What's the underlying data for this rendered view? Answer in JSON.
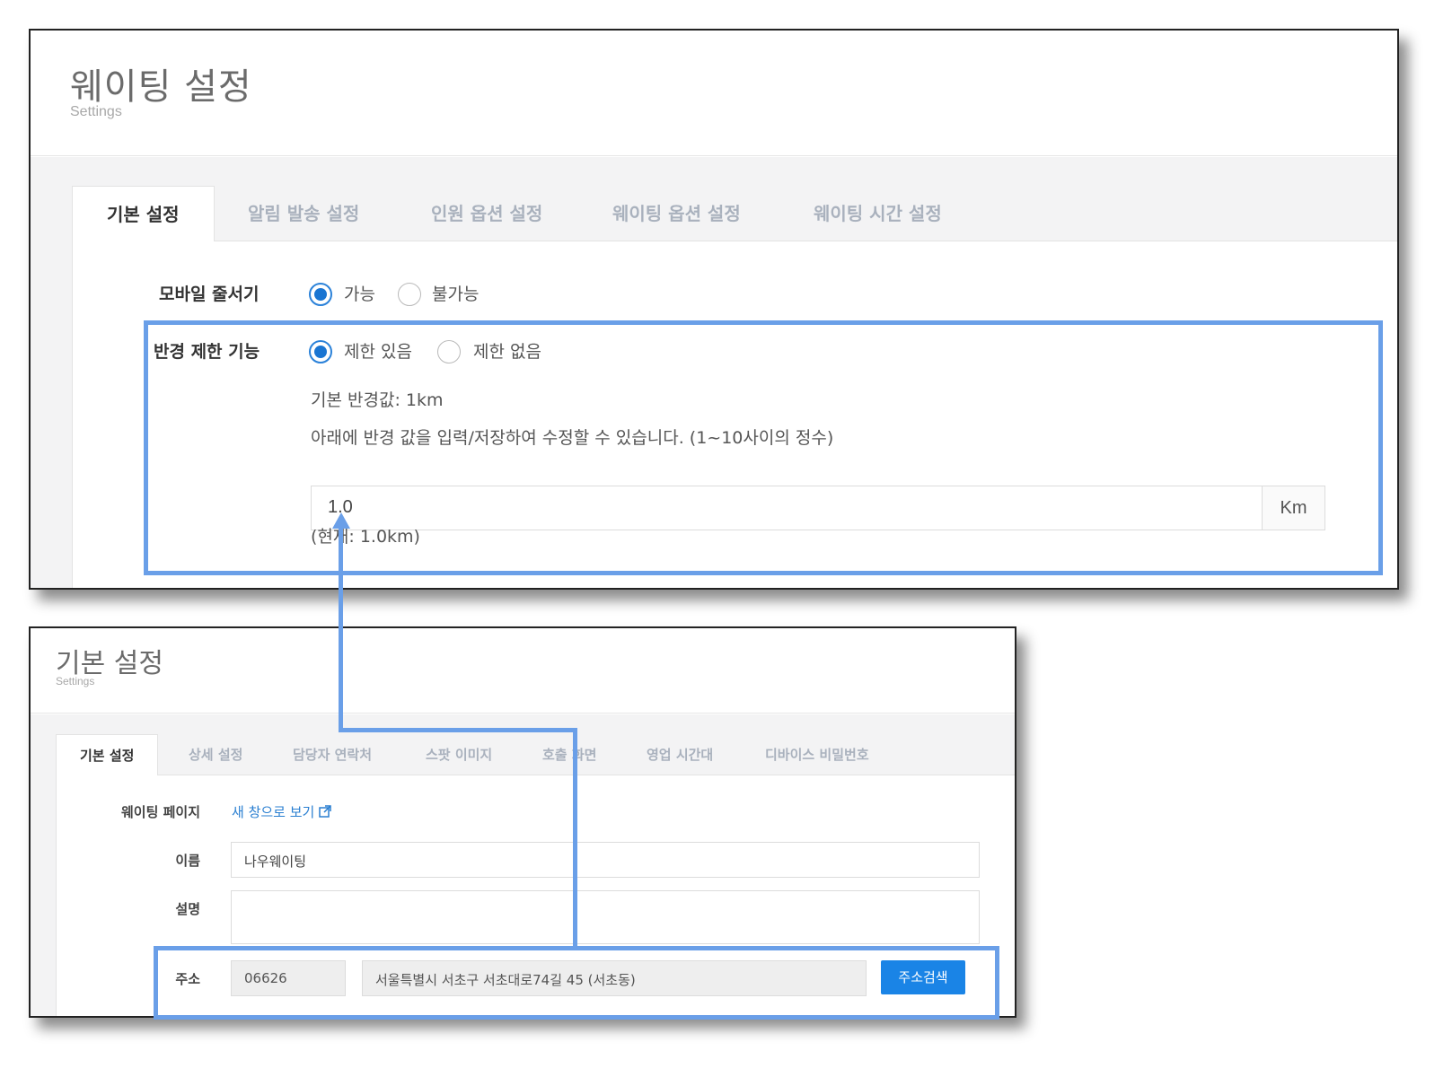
{
  "top_panel": {
    "title": "웨이팅 설정",
    "subtitle": "Settings",
    "tabs": [
      "기본 설정",
      "알림 발송 설정",
      "인원 옵션 설정",
      "웨이팅 옵션 설정",
      "웨이팅 시간 설정"
    ],
    "active_tab": "기본 설정",
    "mobile_queue": {
      "label": "모바일 줄서기",
      "options": [
        "가능",
        "불가능"
      ],
      "selected": "가능"
    },
    "radius_limit": {
      "label": "반경 제한 기능",
      "options": [
        "제한 있음",
        "제한 없음"
      ],
      "selected": "제한 있음",
      "default_text": "기본 반경값: 1km",
      "hint_text": "아래에 반경 값을 입력/저장하여 수정할 수 있습니다. (1~10사이의 정수)",
      "input_value": "1.0",
      "unit": "Km",
      "current_text": "(현재: 1.0km)"
    }
  },
  "bottom_panel": {
    "title": "기본 설정",
    "subtitle": "Settings",
    "tabs": [
      "기본 설정",
      "상세 설정",
      "담당자 연락처",
      "스팟 이미지",
      "호출 화면",
      "영업 시간대",
      "디바이스 비밀번호"
    ],
    "active_tab": "기본 설정",
    "waiting_page": {
      "label": "웨이팅 페이지",
      "link": "새 창으로 보기"
    },
    "name": {
      "label": "이름",
      "value": "나우웨이팅"
    },
    "description": {
      "label": "설명",
      "value": ""
    },
    "address": {
      "label": "주소",
      "zipcode": "06626",
      "full": "서울특별시 서초구 서초대로74길 45 (서초동)",
      "button": "주소검색"
    }
  },
  "colors": {
    "highlight": "#6a9fe8",
    "radio_active": "#1a75d2",
    "link": "#2a7fd1",
    "button": "#1a84e6",
    "tab_inactive": "#a9b1bd"
  }
}
